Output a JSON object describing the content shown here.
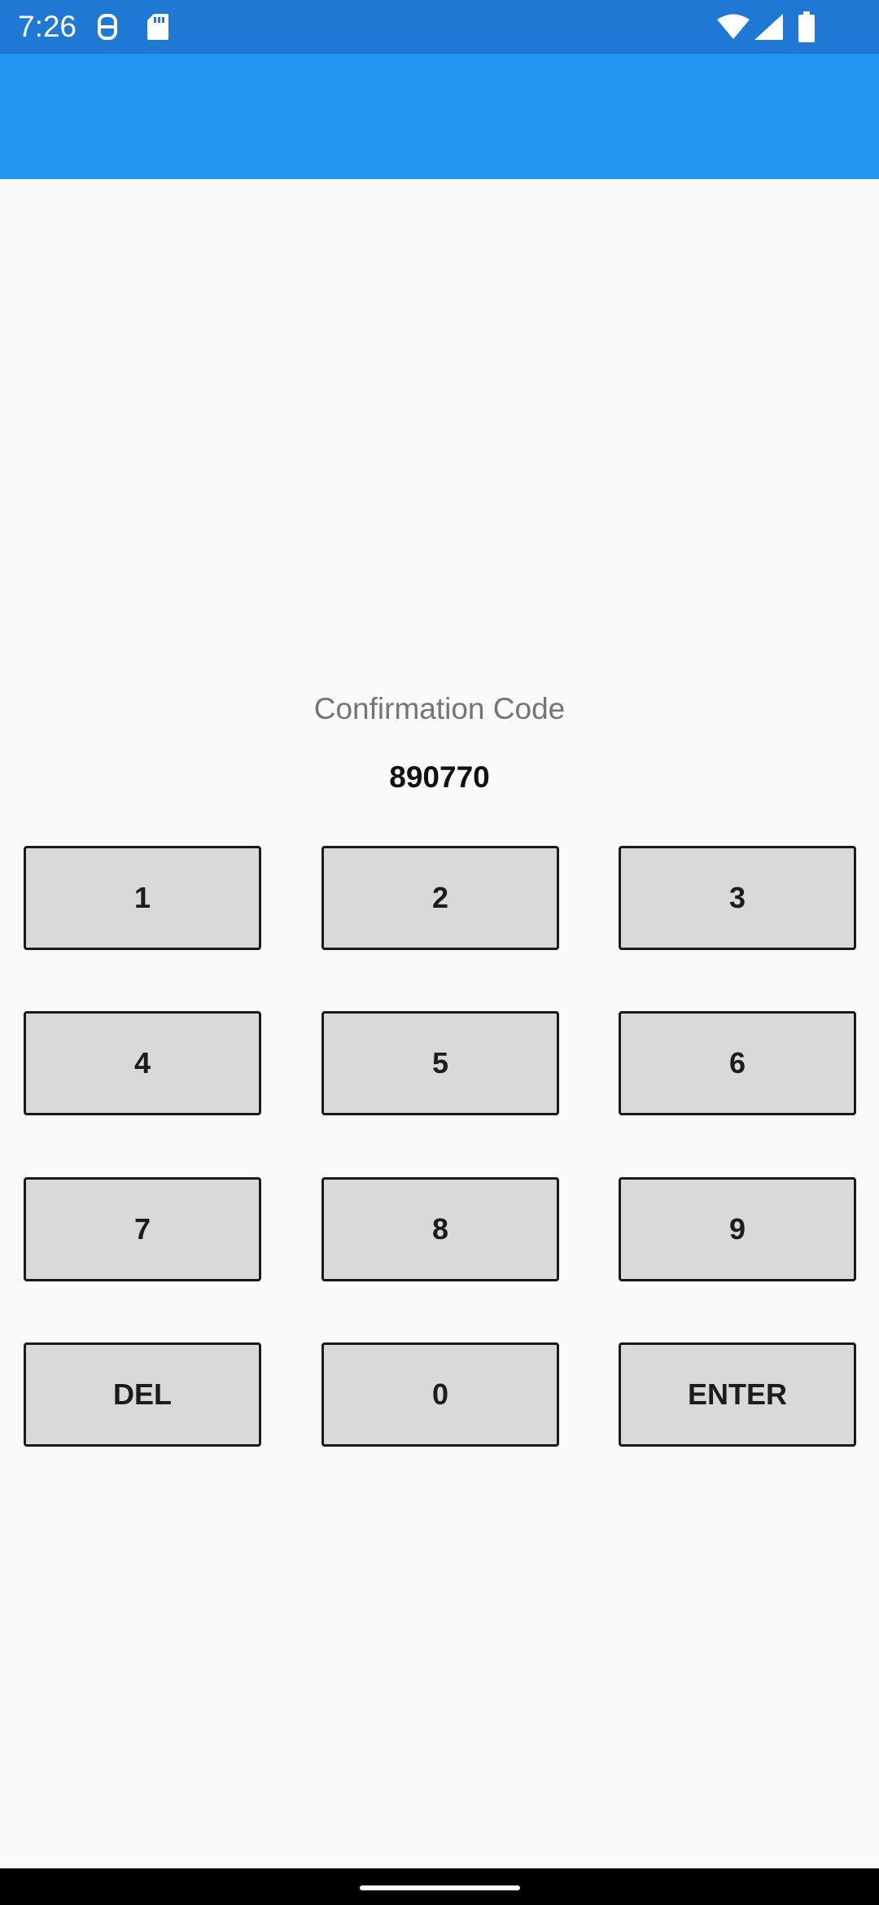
{
  "status_bar": {
    "time": "7:26",
    "icons": [
      "data-saver-icon",
      "sd-card-icon",
      "wifi-icon",
      "cellular-signal-icon",
      "battery-icon"
    ]
  },
  "colors": {
    "status_bar": "#1e78d4",
    "app_bar": "#2196f3",
    "background": "#fafafa",
    "key_fill": "#d8d9d9",
    "key_border": "#1a1a1a"
  },
  "confirmation": {
    "label": "Confirmation Code",
    "code": "890770"
  },
  "keypad": {
    "rows": [
      [
        "1",
        "2",
        "3"
      ],
      [
        "4",
        "5",
        "6"
      ],
      [
        "7",
        "8",
        "9"
      ],
      [
        "DEL",
        "0",
        "ENTER"
      ]
    ]
  }
}
